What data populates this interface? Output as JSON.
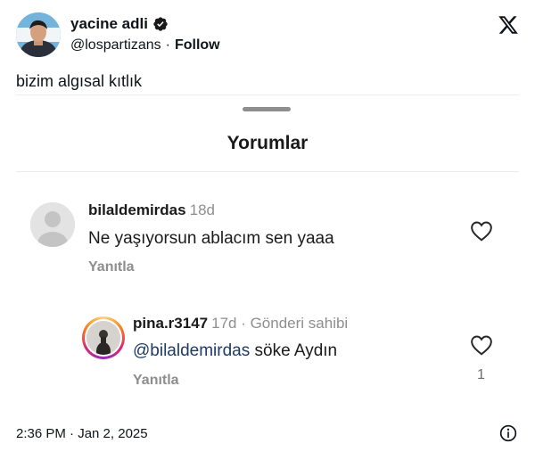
{
  "author": {
    "name": "yacine adli",
    "handle": "@lospartizans",
    "separator": "·",
    "follow_label": "Follow",
    "verified_icon": "verified-badge-icon"
  },
  "tweet": {
    "text": "bizim algısal kıtlık",
    "timestamp": "2:36 PM · Jan 2, 2025"
  },
  "comments_card": {
    "title": "Yorumlar",
    "comment": {
      "username": "bilaldemirdas",
      "age": "18d",
      "text": "Ne yaşıyorsun ablacım sen yaaa",
      "reply_label": "Yanıtla"
    },
    "reply": {
      "username": "pina.r3147",
      "meta": "17d · Gönderi sahibi",
      "mention": "@bilaldemirdas",
      "text": " söke Aydın",
      "reply_label": "Yanıtla",
      "like_count": "1"
    }
  },
  "colors": {
    "text": "#0f1419",
    "muted": "#8e8e8e",
    "mention": "#1e3a66"
  }
}
